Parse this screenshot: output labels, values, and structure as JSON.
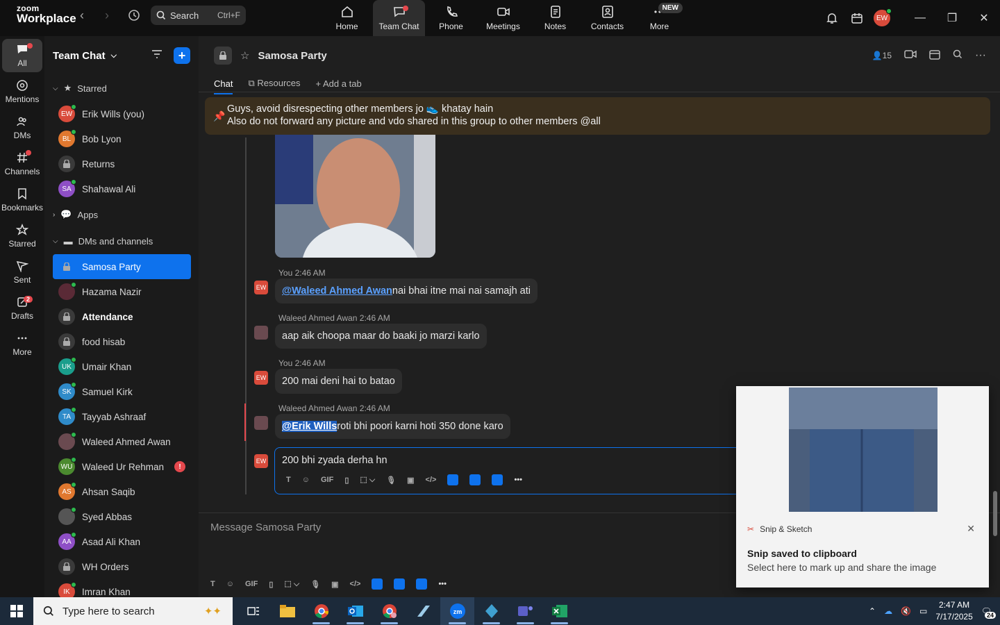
{
  "app": {
    "brand_top": "zoom",
    "brand_bottom": "Workplace"
  },
  "search": {
    "label": "Search",
    "shortcut": "Ctrl+F"
  },
  "topnav": [
    {
      "label": "Home",
      "icon": "home-icon"
    },
    {
      "label": "Team Chat",
      "icon": "chat-icon"
    },
    {
      "label": "Phone",
      "icon": "phone-icon"
    },
    {
      "label": "Meetings",
      "icon": "video-icon"
    },
    {
      "label": "Notes",
      "icon": "notes-icon"
    },
    {
      "label": "Contacts",
      "icon": "contacts-icon"
    },
    {
      "label": "More",
      "icon": "more-icon",
      "badge": "NEW"
    }
  ],
  "user": {
    "initials": "EW"
  },
  "rail": [
    {
      "label": "All",
      "icon": "chat-bubble-icon"
    },
    {
      "label": "Mentions",
      "icon": "at-icon"
    },
    {
      "label": "DMs",
      "icon": "people-icon"
    },
    {
      "label": "Channels",
      "icon": "hash-icon"
    },
    {
      "label": "Bookmarks",
      "icon": "bookmark-icon"
    },
    {
      "label": "Starred",
      "icon": "star-icon"
    },
    {
      "label": "Sent",
      "icon": "send-icon"
    },
    {
      "label": "Drafts",
      "icon": "draft-icon",
      "badge": "2"
    },
    {
      "label": "More",
      "icon": "ellipsis-icon"
    }
  ],
  "sidebar": {
    "title": "Team Chat",
    "sections": {
      "starred": "Starred",
      "apps": "Apps",
      "dms": "DMs and channels"
    },
    "starred": [
      {
        "initials": "EW",
        "name": "Erik Wills (you)",
        "color": "#d94b3b"
      },
      {
        "initials": "BL",
        "name": "Bob Lyon",
        "color": "#e0782f"
      },
      {
        "initials": "",
        "name": "Returns",
        "color": "",
        "lock": true
      },
      {
        "initials": "SA",
        "name": "Shahawal Ali",
        "color": "#8e4fc6"
      }
    ],
    "channels": [
      {
        "initials": "",
        "name": "Samosa Party",
        "lock": true
      },
      {
        "initials": "",
        "name": "Hazama Nazir",
        "color": "#5a2a36"
      },
      {
        "initials": "",
        "name": "Attendance",
        "lock": true
      },
      {
        "initials": "",
        "name": "food hisab",
        "lock": true
      },
      {
        "initials": "UK",
        "name": "Umair Khan",
        "color": "#1a9e8c"
      },
      {
        "initials": "SK",
        "name": "Samuel Kirk",
        "color": "#2f8bc9"
      },
      {
        "initials": "TA",
        "name": "Tayyab Ashraaf",
        "color": "#2f8bc9"
      },
      {
        "initials": "",
        "name": "Waleed Ahmed Awan",
        "color": "#6a4a50"
      },
      {
        "initials": "WU",
        "name": "Waleed Ur Rehman",
        "color": "#4b8a2f",
        "error": "!"
      },
      {
        "initials": "AS",
        "name": "Ahsan Saqib",
        "color": "#e0782f"
      },
      {
        "initials": "",
        "name": "Syed Abbas",
        "color": "#555"
      },
      {
        "initials": "AA",
        "name": "Asad Ali Khan",
        "color": "#8e4fc6"
      },
      {
        "initials": "",
        "name": "WH Orders",
        "lock": true
      },
      {
        "initials": "IK",
        "name": "Imran Khan",
        "color": "#d94b3b"
      }
    ]
  },
  "channel": {
    "name": "Samosa Party",
    "members": "15",
    "tabs": [
      "Chat",
      "Resources",
      "Add a tab"
    ]
  },
  "pinned": {
    "line1": "Guys, avoid disrespecting other members jo 👟 khatay hain",
    "line2": "Also do not forward any picture and vdo shared in this group to other members @all"
  },
  "messages": [
    {
      "sender": "You",
      "time": "2:46 AM",
      "avatar": "EW",
      "mention": "@Waleed Ahmed Awan",
      "text": " nai bhai itne mai nai samajh ati"
    },
    {
      "sender": "Waleed Ahmed Awan",
      "time": "2:46 AM",
      "text": "aap aik choopa maar do baaki jo marzi karlo"
    },
    {
      "sender": "You",
      "time": "2:46 AM",
      "avatar": "EW",
      "text": "200 mai deni hai to batao"
    },
    {
      "sender": "Waleed Ahmed Awan",
      "time": "2:46 AM",
      "mention": "@Erik Wills",
      "text": " roti bhi poori karni hoti 350 done karo"
    }
  ],
  "reply": {
    "avatar": "EW",
    "text": "200 bhi zyada derha hn"
  },
  "composer": {
    "placeholder": "Message Samosa Party"
  },
  "toast": {
    "app": "Snip & Sketch",
    "title": "Snip saved to clipboard",
    "body": "Select here to mark up and share the image"
  },
  "taskbar": {
    "search_placeholder": "Type here to search",
    "time": "2:47 AM",
    "date": "7/17/2025",
    "notifications": "24"
  }
}
